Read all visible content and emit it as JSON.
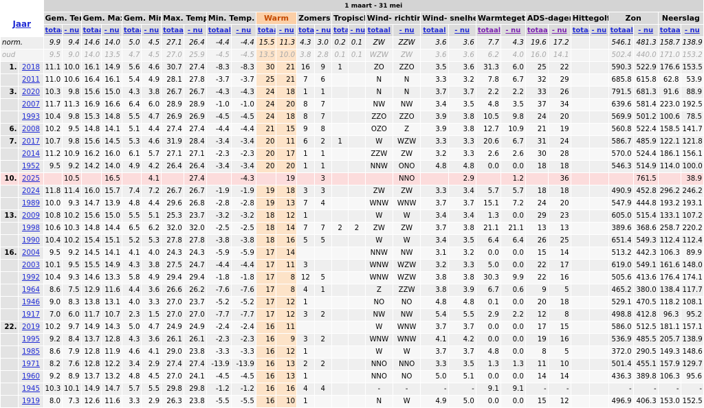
{
  "period": "1 maart - 31 mei",
  "jaar_label": "Jaar",
  "groups": [
    "Gem. Temp.",
    "Gem. Max.",
    "Gem. Min.",
    "Max. Temp.",
    "Min. Temp.",
    "Warm",
    "Zomers",
    "Tropisch",
    "Wind- richting",
    "Wind- snelheid",
    "Warmtegetal",
    "ADS-dagen",
    "Hittegolf",
    "Zon",
    "Neerslag"
  ],
  "sub_totaal": "totaal",
  "sub_nu": "- nu",
  "norm_label": "norm.",
  "oud_label": "oud",
  "norm": [
    "9.9",
    "9.4",
    "14.6",
    "14.0",
    "5.0",
    "4.5",
    "27.1",
    "26.4",
    "-4.4",
    "-4.4",
    "15.5",
    "11.3",
    "4.3",
    "3.0",
    "0.2",
    "0.1",
    "ZW",
    "ZZW",
    "3.6",
    "3.6",
    "7.7",
    "4.3",
    "19.6",
    "17.2",
    "",
    "",
    "546.1",
    "481.3",
    "158.7",
    "138.9"
  ],
  "oud": [
    "9.5",
    "9.0",
    "14.0",
    "13.5",
    "4.7",
    "4.5",
    "27.0",
    "25.9",
    "-4.5",
    "-4.5",
    "13.5",
    "10.0",
    "3.8",
    "2.8",
    "0.1",
    "0.1",
    "WZW",
    "ZW",
    "3.6",
    "3.6",
    "6.2",
    "4.0",
    "16.0",
    "14.1",
    "",
    "",
    "502.4",
    "440.0",
    "171.0",
    "153.2"
  ],
  "rows": [
    {
      "rank": "1.",
      "year": "2018",
      "v": [
        "11.1",
        "10.0",
        "16.1",
        "14.9",
        "5.6",
        "4.6",
        "30.7",
        "27.4",
        "-8.3",
        "-8.3",
        "30",
        "21",
        "16",
        "9",
        "1",
        "",
        "ZO",
        "ZZO",
        "3.5",
        "3.6",
        "31.3",
        "6.0",
        "25",
        "22",
        "",
        "",
        "590.3",
        "522.9",
        "176.6",
        "153.5"
      ]
    },
    {
      "rank": "",
      "year": "2011",
      "v": [
        "11.0",
        "10.6",
        "16.4",
        "16.1",
        "5.4",
        "4.9",
        "28.1",
        "27.8",
        "-3.7",
        "-3.7",
        "25",
        "21",
        "7",
        "6",
        "",
        "",
        "N",
        "N",
        "3.3",
        "3.2",
        "7.8",
        "6.7",
        "32",
        "29",
        "",
        "",
        "685.8",
        "615.8",
        "62.8",
        "53.9"
      ]
    },
    {
      "rank": "3.",
      "year": "2020",
      "v": [
        "10.3",
        "9.8",
        "15.6",
        "15.0",
        "4.3",
        "3.8",
        "26.7",
        "26.7",
        "-4.3",
        "-4.3",
        "24",
        "18",
        "1",
        "1",
        "",
        "",
        "N",
        "N",
        "3.7",
        "3.7",
        "2.2",
        "2.2",
        "33",
        "26",
        "",
        "",
        "791.5",
        "681.3",
        "91.6",
        "88.9"
      ]
    },
    {
      "rank": "",
      "year": "2007",
      "v": [
        "11.7",
        "11.3",
        "16.9",
        "16.6",
        "6.4",
        "6.0",
        "28.9",
        "28.9",
        "-1.0",
        "-1.0",
        "24",
        "20",
        "8",
        "7",
        "",
        "",
        "NW",
        "NW",
        "3.4",
        "3.5",
        "4.8",
        "3.5",
        "37",
        "34",
        "",
        "",
        "639.6",
        "581.4",
        "223.0",
        "192.5"
      ]
    },
    {
      "rank": "",
      "year": "1993",
      "v": [
        "10.4",
        "9.8",
        "15.3",
        "14.8",
        "5.5",
        "4.7",
        "26.9",
        "26.9",
        "-4.5",
        "-4.5",
        "24",
        "18",
        "8",
        "7",
        "",
        "",
        "ZZO",
        "ZZO",
        "3.9",
        "3.8",
        "10.5",
        "9.8",
        "24",
        "20",
        "",
        "",
        "569.9",
        "501.2",
        "100.6",
        "78.5"
      ]
    },
    {
      "rank": "6.",
      "year": "2008",
      "v": [
        "10.2",
        "9.5",
        "14.8",
        "14.1",
        "5.1",
        "4.4",
        "27.4",
        "27.4",
        "-4.4",
        "-4.4",
        "21",
        "15",
        "9",
        "8",
        "",
        "",
        "OZO",
        "Z",
        "3.9",
        "3.8",
        "12.7",
        "10.9",
        "21",
        "19",
        "",
        "",
        "560.8",
        "522.4",
        "158.5",
        "141.7"
      ]
    },
    {
      "rank": "7.",
      "year": "2017",
      "v": [
        "10.7",
        "9.8",
        "15.6",
        "14.5",
        "5.3",
        "4.6",
        "31.9",
        "28.4",
        "-3.4",
        "-3.4",
        "20",
        "11",
        "6",
        "2",
        "1",
        "",
        "W",
        "WZW",
        "3.3",
        "3.3",
        "20.6",
        "6.7",
        "31",
        "24",
        "",
        "",
        "586.7",
        "485.9",
        "122.1",
        "121.8"
      ]
    },
    {
      "rank": "",
      "year": "2014",
      "v": [
        "11.2",
        "10.9",
        "16.2",
        "16.0",
        "6.1",
        "5.7",
        "27.1",
        "27.1",
        "-2.3",
        "-2.3",
        "20",
        "17",
        "1",
        "1",
        "",
        "",
        "ZZW",
        "ZW",
        "3.2",
        "3.3",
        "2.6",
        "2.6",
        "30",
        "28",
        "",
        "",
        "570.0",
        "524.4",
        "186.1",
        "156.1"
      ]
    },
    {
      "rank": "",
      "year": "1952",
      "v": [
        "9.5",
        "9.2",
        "14.2",
        "14.0",
        "4.9",
        "4.2",
        "26.4",
        "26.4",
        "-3.4",
        "-3.4",
        "20",
        "20",
        "1",
        "1",
        "",
        "",
        "NNW",
        "ONO",
        "4.8",
        "4.8",
        "0.0",
        "0.0",
        "18",
        "18",
        "",
        "",
        "546.3",
        "514.9",
        "114.0",
        "100.0"
      ]
    },
    {
      "rank": "10.",
      "year": "2025",
      "hl": true,
      "v": [
        "",
        "10.5",
        "",
        "16.5",
        "",
        "4.1",
        "",
        "27.4",
        "",
        "-4.3",
        "",
        "19",
        "",
        "3",
        "",
        "",
        "",
        "NNO",
        "",
        "2.9",
        "",
        "1.2",
        "",
        "36",
        "",
        "",
        "",
        "761.5",
        "",
        "38.9"
      ]
    },
    {
      "rank": "",
      "year": "2024",
      "v": [
        "11.8",
        "11.4",
        "16.0",
        "15.7",
        "7.4",
        "7.2",
        "26.7",
        "26.7",
        "-1.9",
        "-1.9",
        "19",
        "18",
        "3",
        "3",
        "",
        "",
        "ZW",
        "ZW",
        "3.3",
        "3.4",
        "5.7",
        "5.7",
        "18",
        "18",
        "",
        "",
        "490.9",
        "452.8",
        "296.2",
        "246.2"
      ]
    },
    {
      "rank": "",
      "year": "1989",
      "v": [
        "10.0",
        "9.3",
        "14.7",
        "13.9",
        "4.8",
        "4.4",
        "29.6",
        "26.8",
        "-2.8",
        "-2.8",
        "19",
        "13",
        "7",
        "4",
        "",
        "",
        "WNW",
        "WNW",
        "3.7",
        "3.7",
        "15.1",
        "7.2",
        "24",
        "20",
        "",
        "",
        "547.9",
        "444.8",
        "193.2",
        "193.1"
      ]
    },
    {
      "rank": "13.",
      "year": "2009",
      "v": [
        "10.8",
        "10.2",
        "15.6",
        "15.0",
        "5.5",
        "5.1",
        "25.3",
        "23.7",
        "-3.2",
        "-3.2",
        "18",
        "12",
        "1",
        "",
        "",
        "",
        "W",
        "W",
        "3.4",
        "3.4",
        "1.3",
        "0.0",
        "29",
        "23",
        "",
        "",
        "605.0",
        "515.4",
        "133.1",
        "107.2"
      ]
    },
    {
      "rank": "",
      "year": "1998",
      "v": [
        "10.6",
        "10.3",
        "14.8",
        "14.4",
        "6.5",
        "6.2",
        "32.0",
        "32.0",
        "-2.5",
        "-2.5",
        "18",
        "14",
        "7",
        "7",
        "2",
        "2",
        "ZW",
        "ZW",
        "3.7",
        "3.8",
        "21.1",
        "21.1",
        "13",
        "13",
        "",
        "",
        "389.6",
        "368.6",
        "258.7",
        "220.2"
      ]
    },
    {
      "rank": "",
      "year": "1990",
      "v": [
        "10.4",
        "10.2",
        "15.4",
        "15.1",
        "5.2",
        "5.3",
        "27.8",
        "27.8",
        "-3.8",
        "-3.8",
        "18",
        "16",
        "5",
        "5",
        "",
        "",
        "W",
        "W",
        "3.4",
        "3.5",
        "6.4",
        "6.4",
        "26",
        "25",
        "",
        "",
        "651.4",
        "549.3",
        "112.4",
        "112.4"
      ]
    },
    {
      "rank": "16.",
      "year": "2004",
      "v": [
        "9.5",
        "9.2",
        "14.5",
        "14.1",
        "4.1",
        "4.0",
        "24.3",
        "24.3",
        "-5.9",
        "-5.9",
        "17",
        "14",
        "",
        "",
        "",
        "",
        "NNW",
        "NW",
        "3.1",
        "3.2",
        "0.0",
        "0.0",
        "15",
        "14",
        "",
        "",
        "513.2",
        "442.3",
        "106.3",
        "89.9"
      ]
    },
    {
      "rank": "",
      "year": "2003",
      "v": [
        "10.1",
        "9.5",
        "15.5",
        "14.9",
        "4.3",
        "3.8",
        "27.5",
        "24.7",
        "-4.4",
        "-4.4",
        "17",
        "11",
        "3",
        "",
        "",
        "",
        "WNW",
        "WZW",
        "3.2",
        "3.3",
        "5.0",
        "0.0",
        "22",
        "17",
        "",
        "",
        "619.0",
        "549.1",
        "161.6",
        "148.0"
      ]
    },
    {
      "rank": "",
      "year": "1992",
      "v": [
        "10.4",
        "9.3",
        "14.6",
        "13.3",
        "5.8",
        "4.9",
        "29.4",
        "29.4",
        "-1.8",
        "-1.8",
        "17",
        "8",
        "12",
        "5",
        "",
        "",
        "WNW",
        "WZW",
        "3.8",
        "3.8",
        "30.3",
        "9.9",
        "22",
        "16",
        "",
        "",
        "505.6",
        "413.6",
        "176.4",
        "174.1"
      ]
    },
    {
      "rank": "",
      "year": "1964",
      "v": [
        "8.6",
        "7.5",
        "12.9",
        "11.6",
        "4.4",
        "3.6",
        "26.6",
        "26.2",
        "-7.6",
        "-7.6",
        "17",
        "8",
        "4",
        "1",
        "",
        "",
        "Z",
        "ZZW",
        "3.8",
        "3.9",
        "6.7",
        "0.6",
        "9",
        "5",
        "",
        "",
        "465.2",
        "380.0",
        "138.4",
        "117.7"
      ]
    },
    {
      "rank": "",
      "year": "1946",
      "v": [
        "9.0",
        "8.3",
        "13.8",
        "13.1",
        "4.0",
        "3.3",
        "27.0",
        "23.7",
        "-5.2",
        "-5.2",
        "17",
        "12",
        "1",
        "",
        "",
        "",
        "NO",
        "NO",
        "4.8",
        "4.8",
        "0.1",
        "0.0",
        "20",
        "18",
        "",
        "",
        "529.1",
        "470.5",
        "118.2",
        "108.1"
      ]
    },
    {
      "rank": "",
      "year": "1917",
      "v": [
        "7.0",
        "6.0",
        "11.7",
        "10.7",
        "2.3",
        "1.5",
        "27.0",
        "27.0",
        "-7.7",
        "-7.7",
        "17",
        "12",
        "3",
        "2",
        "",
        "",
        "NW",
        "NW",
        "5.4",
        "5.5",
        "2.9",
        "2.2",
        "12",
        "8",
        "",
        "",
        "498.8",
        "412.8",
        "96.3",
        "95.2"
      ]
    },
    {
      "rank": "22.",
      "year": "2019",
      "v": [
        "10.2",
        "9.7",
        "14.9",
        "14.3",
        "5.0",
        "4.7",
        "24.9",
        "24.9",
        "-2.4",
        "-2.4",
        "16",
        "11",
        "",
        "",
        "",
        "",
        "W",
        "WNW",
        "3.7",
        "3.7",
        "0.0",
        "0.0",
        "17",
        "15",
        "",
        "",
        "586.0",
        "512.5",
        "181.1",
        "157.1"
      ]
    },
    {
      "rank": "",
      "year": "1995",
      "v": [
        "9.2",
        "8.4",
        "13.7",
        "12.8",
        "4.3",
        "3.6",
        "26.1",
        "26.1",
        "-2.3",
        "-2.3",
        "16",
        "9",
        "3",
        "2",
        "",
        "",
        "WNW",
        "WNW",
        "4.1",
        "4.2",
        "0.0",
        "0.0",
        "19",
        "16",
        "",
        "",
        "536.9",
        "485.5",
        "205.7",
        "138.9"
      ]
    },
    {
      "rank": "",
      "year": "1985",
      "v": [
        "8.6",
        "7.9",
        "12.8",
        "11.9",
        "4.6",
        "4.1",
        "29.0",
        "23.8",
        "-3.3",
        "-3.3",
        "16",
        "12",
        "1",
        "",
        "",
        "",
        "W",
        "W",
        "3.7",
        "3.7",
        "4.8",
        "0.0",
        "8",
        "5",
        "",
        "",
        "372.0",
        "290.5",
        "149.3",
        "148.6"
      ]
    },
    {
      "rank": "",
      "year": "1971",
      "v": [
        "8.2",
        "7.6",
        "12.8",
        "12.2",
        "3.4",
        "2.9",
        "27.4",
        "27.4",
        "-13.9",
        "-13.9",
        "16",
        "13",
        "2",
        "2",
        "",
        "",
        "NNO",
        "NNO",
        "3.3",
        "3.5",
        "1.3",
        "1.3",
        "11",
        "10",
        "",
        "",
        "501.4",
        "455.1",
        "157.9",
        "129.7"
      ]
    },
    {
      "rank": "",
      "year": "1960",
      "v": [
        "9.2",
        "8.9",
        "13.7",
        "13.2",
        "4.8",
        "4.5",
        "27.0",
        "24.1",
        "-4.5",
        "-4.5",
        "16",
        "13",
        "1",
        "",
        "",
        "",
        "NNO",
        "NO",
        "5.0",
        "5.1",
        "0.0",
        "0.0",
        "14",
        "14",
        "",
        "",
        "436.3",
        "389.8",
        "106.3",
        "95.6"
      ]
    },
    {
      "rank": "",
      "year": "1945",
      "v": [
        "10.3",
        "10.1",
        "14.9",
        "14.7",
        "5.7",
        "5.5",
        "29.8",
        "29.8",
        "-1.2",
        "-1.2",
        "16",
        "16",
        "4",
        "4",
        "",
        "",
        "-",
        "-",
        "-",
        "-",
        "9.1",
        "9.1",
        "-",
        "-",
        "",
        "",
        "-",
        "-",
        "-",
        "-"
      ]
    },
    {
      "rank": "",
      "year": "1919",
      "v": [
        "8.0",
        "7.3",
        "12.6",
        "11.6",
        "3.3",
        "2.9",
        "26.3",
        "23.8",
        "-5.5",
        "-5.5",
        "16",
        "10",
        "1",
        "",
        "",
        "",
        "N",
        "W",
        "4.9",
        "5.0",
        "0.0",
        "0.0",
        "15",
        "12",
        "",
        "",
        "496.9",
        "406.3",
        "153.0",
        "152.5"
      ]
    }
  ]
}
